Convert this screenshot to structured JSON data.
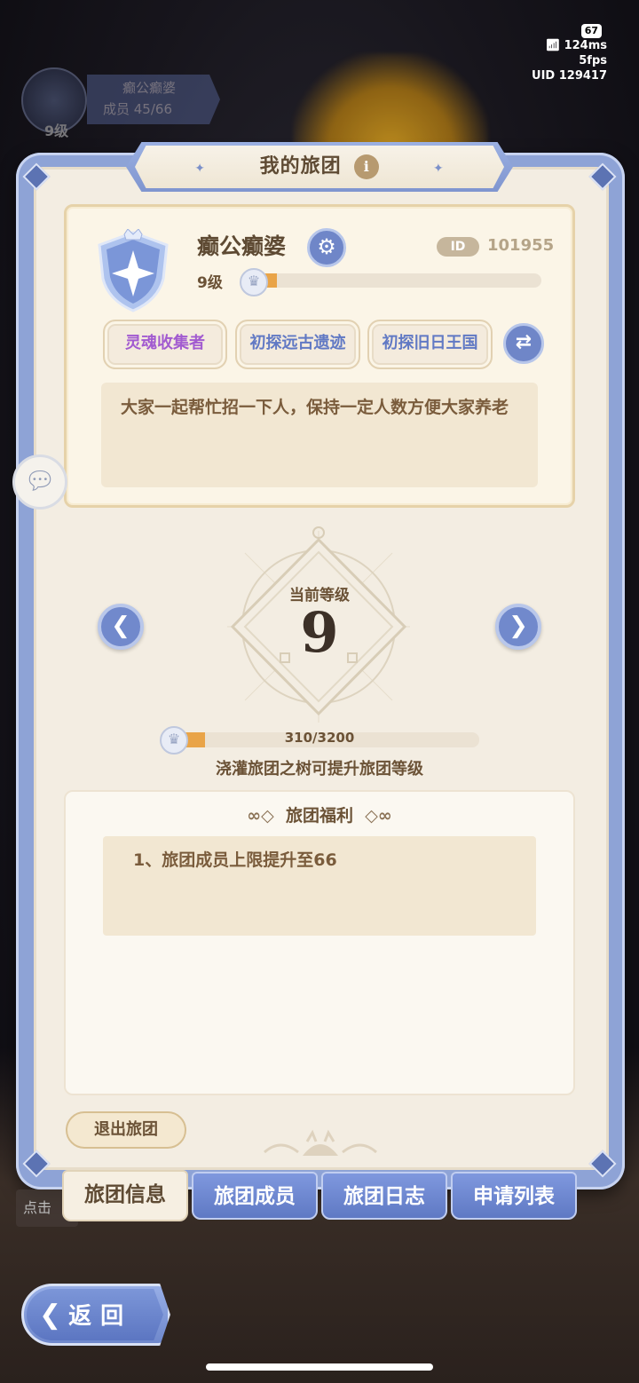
{
  "status_bar": {
    "battery": "67",
    "latency": "124ms",
    "fps": "5fps",
    "uid": "UID 129417"
  },
  "background_guild": {
    "name": "癫公癫婆",
    "members": "成员  45/66",
    "level": "9级"
  },
  "panel": {
    "title": "我的旅团",
    "info_icon": "i"
  },
  "guild": {
    "name": "癫公癫婆",
    "id_label": "ID",
    "id_value": "101955",
    "level_label": "9级",
    "level_progress_pct": 7,
    "tags": [
      {
        "label": "灵魂收集者",
        "color": "#a25bd0"
      },
      {
        "label": "初探远古遗迹",
        "color": "#6179c4"
      },
      {
        "label": "初探旧日王国",
        "color": "#6179c4"
      }
    ],
    "description": "大家一起帮忙招一下人，保持一定人数方便大家养老"
  },
  "level_panel": {
    "caption": "当前等级",
    "level": "9",
    "xp_current": 310,
    "xp_max": 3200,
    "xp_text": "310/3200",
    "hint": "浇灌旅团之树可提升旅团等级"
  },
  "benefits": {
    "title": "旅团福利",
    "items": [
      "1、旅团成员上限提升至66"
    ]
  },
  "leave_button": "退出旅团",
  "tabs": [
    {
      "label": "旅团信息",
      "active": true
    },
    {
      "label": "旅团成员",
      "active": false
    },
    {
      "label": "旅团日志",
      "active": false
    },
    {
      "label": "申请列表",
      "active": false
    }
  ],
  "left_hint": "点击",
  "back_button": "返回",
  "icons": {
    "gear": "gear-icon",
    "swap": "swap-icon",
    "chat": "chat-icon",
    "prev": "arrow-left-icon",
    "next": "arrow-right-icon",
    "crown": "crown-icon",
    "back": "back-chevron-icon"
  },
  "colors": {
    "accent_blue": "#6f86c8",
    "progress_orange": "#e9a448",
    "panel_bg": "#f3ede2"
  }
}
